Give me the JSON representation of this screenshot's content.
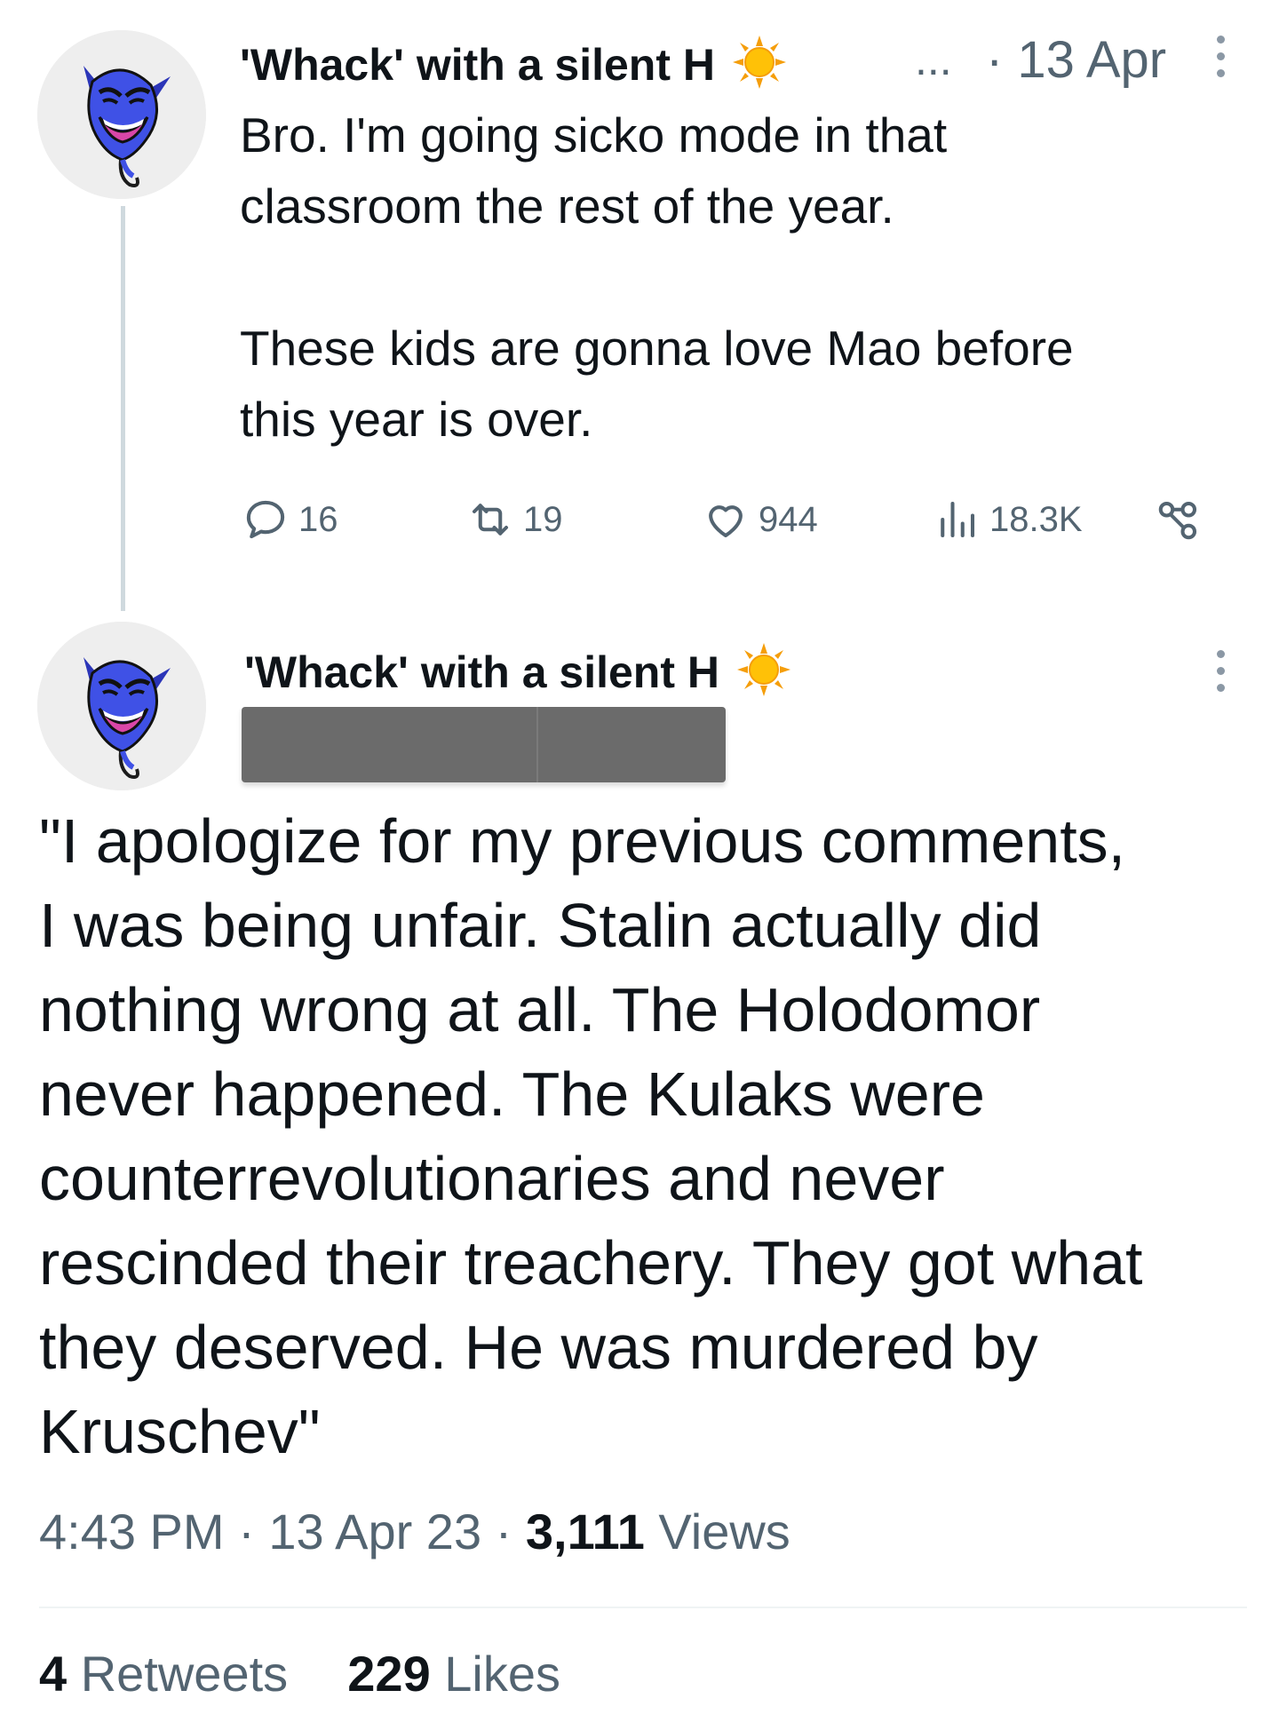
{
  "tweet1": {
    "author": "'Whack' with a silent H",
    "ellipsis": "...",
    "date": "· 13 Apr",
    "text": "Bro. I'm going sicko mode in that\nclassroom the rest of the year.\n\nThese kids are gonna love Mao before\nthis year is over.",
    "replies": "16",
    "retweets": "19",
    "likes": "944",
    "views": "18.3K"
  },
  "tweet2": {
    "author": "'Whack' with a silent H",
    "text": "\"I apologize for my previous comments,\nI was being unfair. Stalin actually did\nnothing wrong at all. The Holodomor\nnever happened. The Kulaks were\ncounterrevolutionaries and never\nrescinded their treachery. They got what\nthey deserved. He was murdered by\nKruschev\"",
    "time": "4:43 PM",
    "date": "13 Apr 23",
    "views_count": "3,111",
    "views_label": "Views",
    "retweets_count": "4",
    "retweets_label": "Retweets",
    "likes_count": "229",
    "likes_label": "Likes"
  },
  "icons": [
    "avatar-genie",
    "sun-emoji",
    "reply-icon",
    "retweet-icon",
    "like-icon",
    "views-icon",
    "share-icon",
    "more-icon"
  ],
  "colors": {
    "text": "#0f1419",
    "secondary": "#536471",
    "avatar_face": "#3f51e6",
    "sun": "#ffb300"
  }
}
